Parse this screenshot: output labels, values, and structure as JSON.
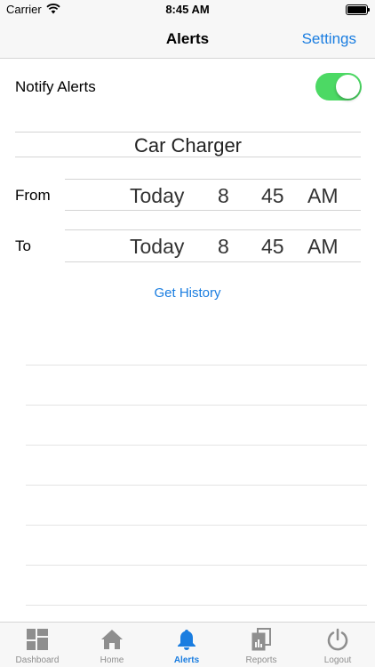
{
  "status_bar": {
    "carrier": "Carrier",
    "time": "8:45 AM"
  },
  "nav": {
    "title": "Alerts",
    "settings_label": "Settings"
  },
  "notify": {
    "label": "Notify Alerts",
    "enabled": true
  },
  "device": {
    "name": "Car Charger"
  },
  "from_row": {
    "label": "From",
    "day": "Today",
    "hour": "8",
    "minute": "45",
    "ampm": "AM"
  },
  "to_row": {
    "label": "To",
    "day": "Today",
    "hour": "8",
    "minute": "45",
    "ampm": "AM"
  },
  "get_history_label": "Get History",
  "history_rows": [],
  "tabs": [
    {
      "label": "Dashboard",
      "icon": "dashboard-icon"
    },
    {
      "label": "Home",
      "icon": "home-icon"
    },
    {
      "label": "Alerts",
      "icon": "bell-icon",
      "active": true
    },
    {
      "label": "Reports",
      "icon": "reports-icon"
    },
    {
      "label": "Logout",
      "icon": "power-icon"
    }
  ],
  "colors": {
    "accent": "#1a7de0",
    "toggle_on": "#4cd964",
    "tab_inactive": "#8e8e8e"
  }
}
